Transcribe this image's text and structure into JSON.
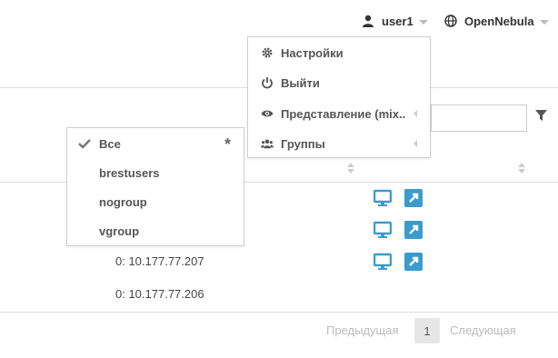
{
  "header": {
    "user": "user1",
    "zone": "OpenNebula"
  },
  "user_menu": {
    "items": [
      {
        "label": "Настройки",
        "icon": "gear-icon"
      },
      {
        "label": "Выйти",
        "icon": "power-icon"
      },
      {
        "label": "Представление (mix..",
        "icon": "eye-icon"
      },
      {
        "label": "Группы",
        "icon": "users-icon"
      }
    ]
  },
  "group_menu": {
    "items": [
      {
        "label": "Все",
        "selected": true
      },
      {
        "label": "brestusers"
      },
      {
        "label": "nogroup"
      },
      {
        "label": "vgroup"
      }
    ],
    "default_marker": "*"
  },
  "table": {
    "rows": [
      {
        "ip": ""
      },
      {
        "ip": ""
      },
      {
        "ip": "0: 10.177.77.207"
      },
      {
        "ip": "0: 10.177.77.206"
      }
    ]
  },
  "pagination": {
    "previous": "Предыдущая",
    "current": "1",
    "next": "Следующая"
  },
  "colors": {
    "accent": "#3a9bcc",
    "border": "#dedede"
  }
}
